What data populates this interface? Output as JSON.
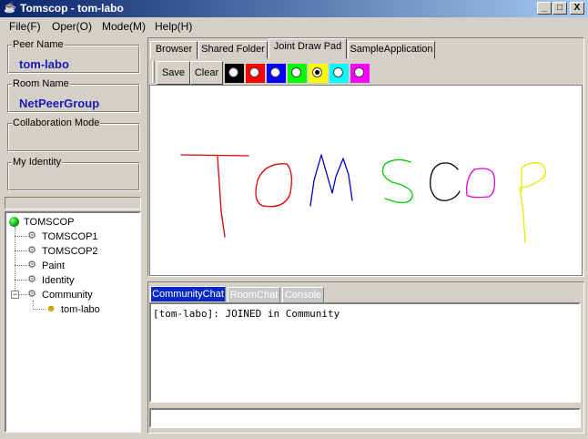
{
  "window": {
    "title": "Tomscop - tom-labo",
    "buttons": {
      "minimize": "_",
      "maximize": "□",
      "close": "X"
    }
  },
  "menu": [
    "File(F)",
    "Oper(O)",
    "Mode(M)",
    "Help(H)"
  ],
  "left": {
    "peer_name_label": "Peer Name",
    "peer_name": "tom-labo",
    "room_name_label": "Room Name",
    "room_name": "NetPeerGroup",
    "collab_label": "Collaboration Mode",
    "identity_label": "My Identity",
    "tree": {
      "root": "TOMSCOP",
      "children": [
        "TOMSCOP1",
        "TOMSCOP2",
        "Paint",
        "Identity",
        "Community"
      ],
      "community_child": "tom-labo"
    }
  },
  "tabs": [
    "Browser",
    "Shared Folder",
    "Joint Draw Pad",
    "SampleApplication"
  ],
  "active_tab": "Joint Draw Pad",
  "toolbar": {
    "save": "Save",
    "clear": "Clear",
    "colors": [
      "#000000",
      "#ff0000",
      "#0000ff",
      "#00ff00",
      "#ffff00",
      "#00ffff",
      "#ff00ff"
    ],
    "selected_color": "#ffff00"
  },
  "drawing": {
    "letters": [
      "T",
      "O",
      "M",
      "S",
      "C",
      "O",
      "P"
    ]
  },
  "chat_tabs": [
    "CommunityChat",
    "RoomChat",
    "Console"
  ],
  "active_chat_tab": "CommunityChat",
  "chat": {
    "log": "[tom-labo]: JOINED in Community",
    "input": ""
  }
}
